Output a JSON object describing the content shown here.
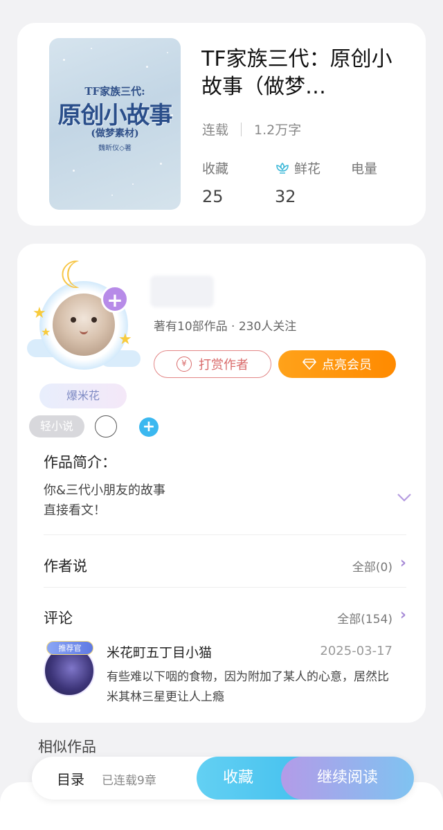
{
  "book": {
    "cover": {
      "series": "TF家族三代:",
      "main": "原创小故事",
      "subtitle": "(做梦素材)",
      "author": "魏昕仪◇著"
    },
    "title": "TF家族三代：原创小故事（做梦…",
    "status": "连载",
    "word_count": "1.2万字",
    "stats": [
      {
        "label": "收藏",
        "value": "25",
        "icon": null
      },
      {
        "label": "鲜花",
        "value": "32",
        "icon": "flower-icon"
      },
      {
        "label": "电量",
        "value": "",
        "icon": null
      }
    ]
  },
  "author": {
    "avatar_tag": "爆米花",
    "stats_text": "著有10部作品 · 230人关注",
    "tip_button": "打赏作者",
    "vip_button": "点亮会员",
    "plus_symbol": "+",
    "tags": [
      "轻小说"
    ]
  },
  "intro": {
    "title": "作品简介：",
    "text": "你&三代小朋友的故事\n直接看文！"
  },
  "author_says": {
    "title": "作者说",
    "more": "全部(0)"
  },
  "comments": {
    "title": "评论",
    "more": "全部(154)",
    "items": [
      {
        "badge": "推荐官",
        "name": "米花町五丁目小猫",
        "date": "2025-03-17",
        "text": "有些难以下咽的食物，因为附加了某人的心意，居然比米其林三星更让人上瘾"
      }
    ]
  },
  "similar": {
    "title": "相似作品"
  },
  "bottom_bar": {
    "toc": "目录",
    "chapters": "已连载9章",
    "collect": "收藏",
    "read": "继续阅读"
  },
  "colors": {
    "accent_orange": "#ff8a00",
    "accent_purple": "#b78be8",
    "accent_blue": "#43c0ee",
    "tip_red": "#d96a6a"
  }
}
